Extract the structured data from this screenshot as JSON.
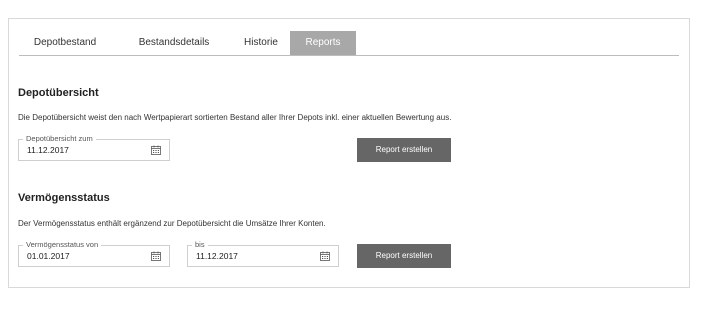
{
  "tabs": [
    {
      "label": "Depotbestand"
    },
    {
      "label": "Bestandsdetails"
    },
    {
      "label": "Historie"
    },
    {
      "label": "Reports",
      "active": true
    }
  ],
  "depot": {
    "title": "Depotübersicht",
    "description": "Die Depotübersicht weist den nach Wertpapierart sortierten Bestand aller Ihrer Depots inkl. einer aktuellen Bewertung aus.",
    "date_label": "Depotübersicht zum",
    "date_value": "11.12.2017",
    "button_label": "Report erstellen"
  },
  "vermoegen": {
    "title": "Vermögensstatus",
    "description": "Der Vermögensstatus enthält ergänzend zur Depotübersicht die Umsätze Ihrer Konten.",
    "from_label": "Vermögensstatus von",
    "from_value": "01.01.2017",
    "to_label": "bis",
    "to_value": "11.12.2017",
    "button_label": "Report erstellen"
  },
  "colors": {
    "active_tab": "#a8a8a8",
    "button": "#666666",
    "border": "#cfcfcf"
  },
  "icons": {
    "date_picker": "calendar-icon"
  }
}
